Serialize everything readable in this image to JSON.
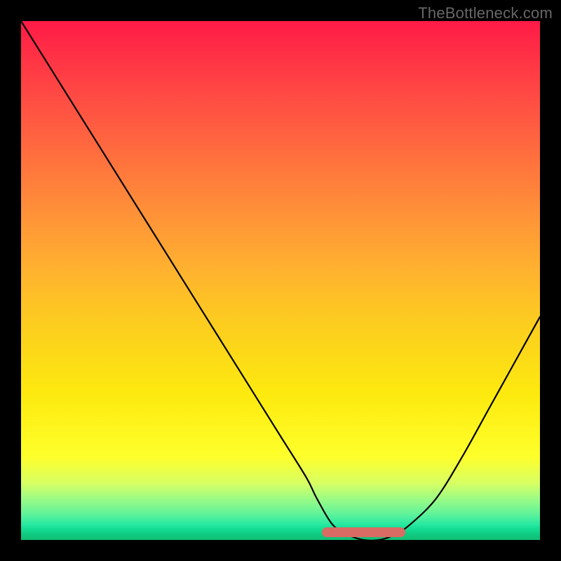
{
  "watermark": "TheBottleneck.com",
  "chart_data": {
    "type": "line",
    "title": "",
    "xlabel": "",
    "ylabel": "",
    "xlim": [
      0,
      100
    ],
    "ylim": [
      0,
      100
    ],
    "grid": false,
    "legend": false,
    "series": [
      {
        "name": "curve",
        "x": [
          0,
          5,
          10,
          15,
          20,
          25,
          30,
          35,
          40,
          45,
          50,
          55,
          57,
          60,
          63,
          66,
          69,
          72,
          75,
          80,
          85,
          90,
          95,
          100
        ],
        "y": [
          100,
          92,
          84,
          76,
          68,
          60,
          52,
          44,
          36,
          28,
          20,
          12,
          8,
          3,
          1,
          0,
          0,
          1,
          3,
          8,
          16,
          25,
          34,
          43
        ]
      }
    ],
    "highlight_segment": {
      "x_start": 58,
      "x_end": 74,
      "note": "flat-bottom marker"
    },
    "gradient_stops": [
      {
        "pct": 0,
        "color": "#ff1a47"
      },
      {
        "pct": 14,
        "color": "#ff4944"
      },
      {
        "pct": 36,
        "color": "#ff8e39"
      },
      {
        "pct": 58,
        "color": "#fccc1f"
      },
      {
        "pct": 84,
        "color": "#feff2b"
      },
      {
        "pct": 95,
        "color": "#60f39a"
      },
      {
        "pct": 100,
        "color": "#11be74"
      }
    ]
  }
}
